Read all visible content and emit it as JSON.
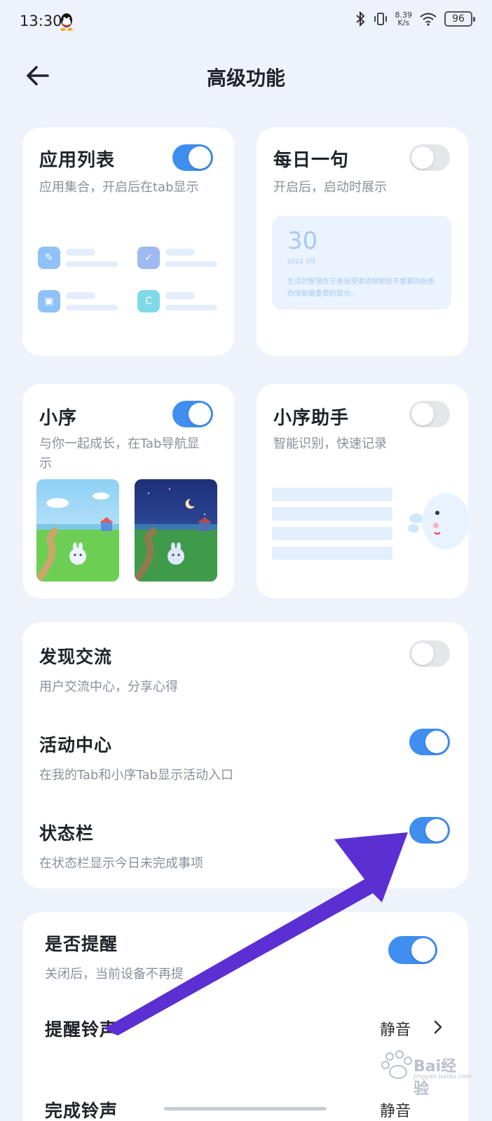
{
  "status": {
    "time": "13:30",
    "net_speed_top": "8.39",
    "net_speed_unit": "K/s",
    "battery": "96"
  },
  "header": {
    "title": "高级功能"
  },
  "app_list": {
    "title": "应用列表",
    "subtitle": "应用集合，开启后在tab显示",
    "toggle": true
  },
  "daily_quote": {
    "title": "每日一句",
    "subtitle": "开启后，启动时展示",
    "toggle": false,
    "preview_day": "30",
    "preview_date": "2022 3月",
    "preview_text": "生活的智慧在于逐渐澄清滤除那些不重要的杂质而保留最重要的部分。"
  },
  "xiaoxu": {
    "title": "小序",
    "subtitle": "与你一起成长，在Tab导航显示",
    "toggle": true
  },
  "xiaoxu_assistant": {
    "title": "小序助手",
    "subtitle": "智能识别，快速记录",
    "toggle": false
  },
  "list_card": {
    "rows": [
      {
        "title": "发现交流",
        "subtitle": "用户交流中心，分享心得",
        "toggle": false
      },
      {
        "title": "活动中心",
        "subtitle": "在我的Tab和小序Tab显示活动入口",
        "toggle": true
      },
      {
        "title": "状态栏",
        "subtitle": "在状态栏显示今日未完成事项",
        "toggle": true
      }
    ]
  },
  "reminder_card": {
    "remind_title": "是否提醒",
    "remind_subtitle": "关闭后，当前设备不再提",
    "remind_toggle": true,
    "ringtone_label": "提醒铃声",
    "ringtone_value": "静音",
    "partial_label": "完成铃声",
    "partial_value": "静音"
  },
  "watermark": {
    "text": "Bai经验",
    "sub": "jingyan.baidu.com"
  },
  "colors": {
    "accent": "#3f8ef0",
    "arrow": "#5b2fd1",
    "background": "#eef2fb"
  }
}
